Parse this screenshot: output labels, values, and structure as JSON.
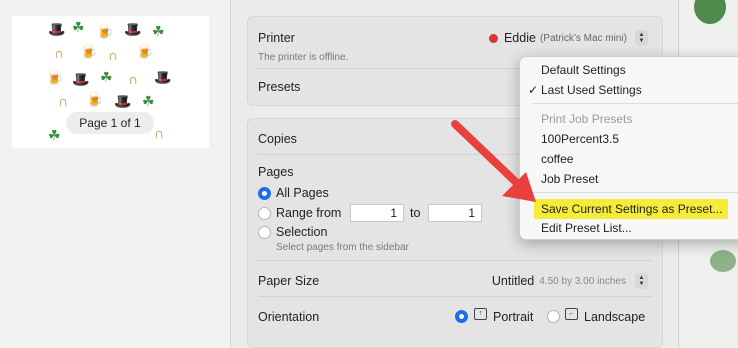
{
  "preview": {
    "page_indicator": "Page 1 of 1"
  },
  "printer": {
    "label": "Printer",
    "name": "Eddie",
    "host": "(Patrick’s Mac mini)",
    "status": "The printer is offline."
  },
  "presets": {
    "label": "Presets"
  },
  "copies": {
    "label": "Copies"
  },
  "pages": {
    "label": "Pages",
    "all_pages": "All Pages",
    "range_from": "Range from",
    "range_start": "1",
    "range_to": "to",
    "range_end": "1",
    "selection": "Selection",
    "selection_hint": "Select pages from the sidebar"
  },
  "paper_size": {
    "label": "Paper Size",
    "value": "Untitled",
    "dimensions": "4.50 by 3.00 inches"
  },
  "orientation": {
    "label": "Orientation",
    "portrait": "Portrait",
    "landscape": "Landscape"
  },
  "preset_menu": {
    "default_settings": "Default Settings",
    "last_used_settings": "Last Used Settings",
    "checkmark": "✓",
    "section_header": "Print Job Presets",
    "preset_1": "100Percent3.5",
    "preset_2": "coffee",
    "preset_3": "Job Preset",
    "save_current": "Save Current Settings as Preset...",
    "edit_list": "Edit Preset List..."
  },
  "colors": {
    "accent": "#1c6ee8",
    "highlight": "#f4ec38",
    "arrow": "#e8403c"
  }
}
